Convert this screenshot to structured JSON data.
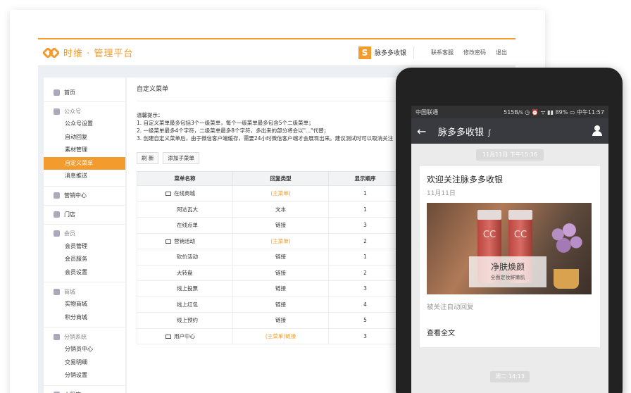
{
  "desktop": {
    "brand": "时维 · 管理平台",
    "merchant_logo": "S",
    "merchant_name": "脉多多收银",
    "links": [
      "联系客服",
      "修改密码",
      "退出"
    ],
    "sidebar": [
      {
        "head": "首页",
        "icon": "home-icon",
        "items": []
      },
      {
        "head": "公众号",
        "icon": "user-group-icon",
        "items": [
          "公众号设置",
          "自动回复",
          "素材管理",
          "自定义菜单",
          "消息推送"
        ]
      },
      {
        "head": "营销中心",
        "icon": "gift-icon",
        "items": []
      },
      {
        "head": "门店",
        "icon": "store-icon",
        "items": []
      },
      {
        "head": "会员",
        "icon": "member-icon",
        "items": [
          "会员管理",
          "会员服务",
          "会员设置"
        ]
      },
      {
        "head": "商城",
        "icon": "shop-icon",
        "items": [
          "实物商城",
          "积分商城"
        ]
      },
      {
        "head": "分销系统",
        "icon": "distribution-icon",
        "items": [
          "分销员中心",
          "交易明细",
          "分销设置"
        ]
      },
      {
        "head": "小程序",
        "icon": "miniapp-icon",
        "items": []
      }
    ],
    "active_item": "自定义菜单",
    "page_title": "自定义菜单",
    "tips": [
      "温馨提示：",
      "1. 自定义菜单最多包括3个一级菜单，每个一级菜单最多包含5个二级菜单；",
      "2. 一级菜单最多4个字符，二级菜单最多8个字符，多出来的部分将会以\"...\"代替；",
      "3. 创建自定义菜单后，由于微信客户端缓存，需要24小时微信客户端才会展现出来。建议测试时可以取消关注"
    ],
    "buttons": {
      "refresh": "刷 新",
      "add_sub": "添加子菜单"
    },
    "table": {
      "headers": [
        "菜单名称",
        "回复类型",
        "显示顺序"
      ],
      "rows": [
        {
          "name": "在线商城",
          "level": 1,
          "type": "(主菜单)",
          "type_color": "orange",
          "order": "1"
        },
        {
          "name": "阿达瓦大",
          "level": 2,
          "type": "文本",
          "type_color": "normal",
          "order": "1"
        },
        {
          "name": "在线点单",
          "level": 2,
          "type": "链接",
          "type_color": "normal",
          "order": "3"
        },
        {
          "name": "营销活动",
          "level": 1,
          "type": "(主菜单)",
          "type_color": "orange",
          "order": "2"
        },
        {
          "name": "砍价活动",
          "level": 2,
          "type": "链接",
          "type_color": "normal",
          "order": "1"
        },
        {
          "name": "大转盘",
          "level": 2,
          "type": "链接",
          "type_color": "normal",
          "order": "2"
        },
        {
          "name": "线上投票",
          "level": 2,
          "type": "链接",
          "type_color": "normal",
          "order": "3"
        },
        {
          "name": "线上红包",
          "level": 2,
          "type": "链接",
          "type_color": "normal",
          "order": "4"
        },
        {
          "name": "线上预约",
          "level": 2,
          "type": "链接",
          "type_color": "normal",
          "order": "5"
        },
        {
          "name": "用户中心",
          "level": 1,
          "type": "(主菜单)链接",
          "type_color": "orange",
          "order": "3"
        }
      ]
    }
  },
  "phone": {
    "status_left": "中国联通",
    "status_right": "515B/s ◷ ⏰ ᯤ ▮▮ 89% ▭ 中午11:57",
    "back": "←",
    "title": "脉多多收银",
    "time1": "11月11日 下午15:36",
    "card": {
      "title": "欢迎关注脉多多收银",
      "date": "11月11日",
      "cc1": "CC",
      "cc2": "CC",
      "promo_main": "净肤焕颜",
      "promo_sub": "全面定妆鲜嫩肌",
      "desc": "被关注自动回复",
      "link": "查看全文"
    },
    "time2": "周二 14:13"
  },
  "colors": {
    "accent": "#f39c2d",
    "wechat_bar": "#393a3f"
  }
}
